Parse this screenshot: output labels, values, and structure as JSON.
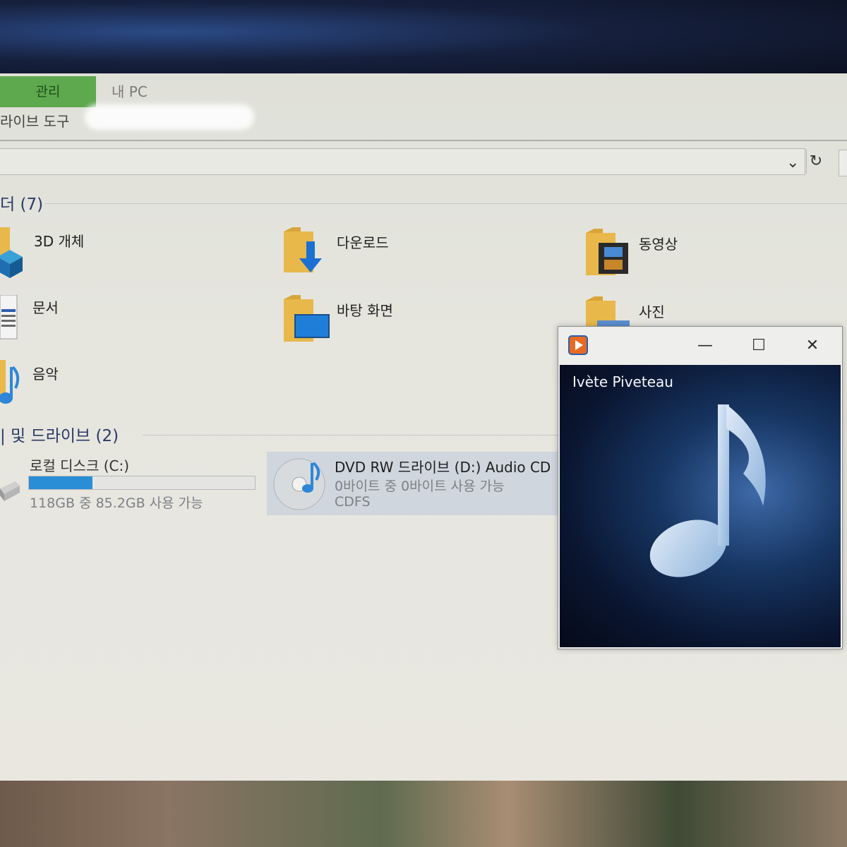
{
  "ribbon": {
    "tab_manage": "관리",
    "tab_mypc": "내 PC",
    "tools_label": "라이브 도구"
  },
  "address": {
    "chevron": "⌄",
    "refresh": "↻"
  },
  "folders_group": {
    "title": "더 (7)",
    "items": [
      {
        "label": "3D 개체"
      },
      {
        "label": "다운로드"
      },
      {
        "label": "동영상"
      },
      {
        "label": "문서"
      },
      {
        "label": "바탕 화면"
      },
      {
        "label": "사진"
      },
      {
        "label": "음악"
      }
    ]
  },
  "drives_group": {
    "title": "| 및 드라이브 (2)",
    "local_disk": {
      "name": "로컬 디스크 (C:)",
      "space": "118GB 중 85.2GB 사용 가능",
      "free_fraction": 0.28
    },
    "dvd": {
      "name": "DVD RW 드라이브 (D:) Audio CD",
      "space": "0바이트 중 0바이트 사용 가능",
      "filesystem": "CDFS"
    }
  },
  "player": {
    "artist": "Ivète Piveteau",
    "minimize": "—",
    "maximize": "☐",
    "close": "✕"
  },
  "colors": {
    "manage_tab": "#5ea84e",
    "progress_fill": "#2a8ed6",
    "folder": "#e8b84a"
  }
}
